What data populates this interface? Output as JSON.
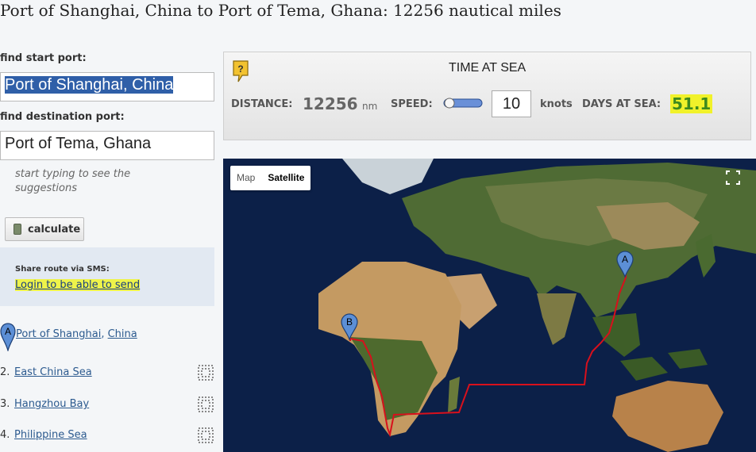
{
  "page_title": "Port of Shanghai, China to Port of Tema, Ghana: 12256 nautical miles",
  "start": {
    "label": "find start port:",
    "value": "Port of Shanghai, China"
  },
  "destination": {
    "label": "find destination port:",
    "value": "Port of Tema, Ghana"
  },
  "hint": "start typing to see the suggestions",
  "calculate_label": "calculate",
  "sms": {
    "title": "Share route via SMS:",
    "link": "Login to be able to send"
  },
  "route": {
    "first": {
      "marker": "A",
      "port": "Port of Shanghai",
      "sep": ", ",
      "country": "China"
    },
    "items": [
      {
        "num": "2.",
        "name": "East China Sea"
      },
      {
        "num": "3.",
        "name": "Hangzhou Bay"
      },
      {
        "num": "4.",
        "name": "Philippine Sea"
      }
    ]
  },
  "time_at_sea": {
    "help": "?",
    "title": "TIME AT SEA",
    "distance_label": "DISTANCE:",
    "distance_value": "12256",
    "distance_unit": "nm",
    "speed_label": "SPEED:",
    "speed_value": "10",
    "speed_unit": "knots",
    "days_label": "DAYS AT SEA:",
    "days_value": "51.1"
  },
  "map": {
    "type_map": "Map",
    "type_satellite": "Satellite",
    "marker_a": "A",
    "marker_b": "B",
    "route_color": "#d8101c",
    "marker_color": "#5c8fd6"
  }
}
